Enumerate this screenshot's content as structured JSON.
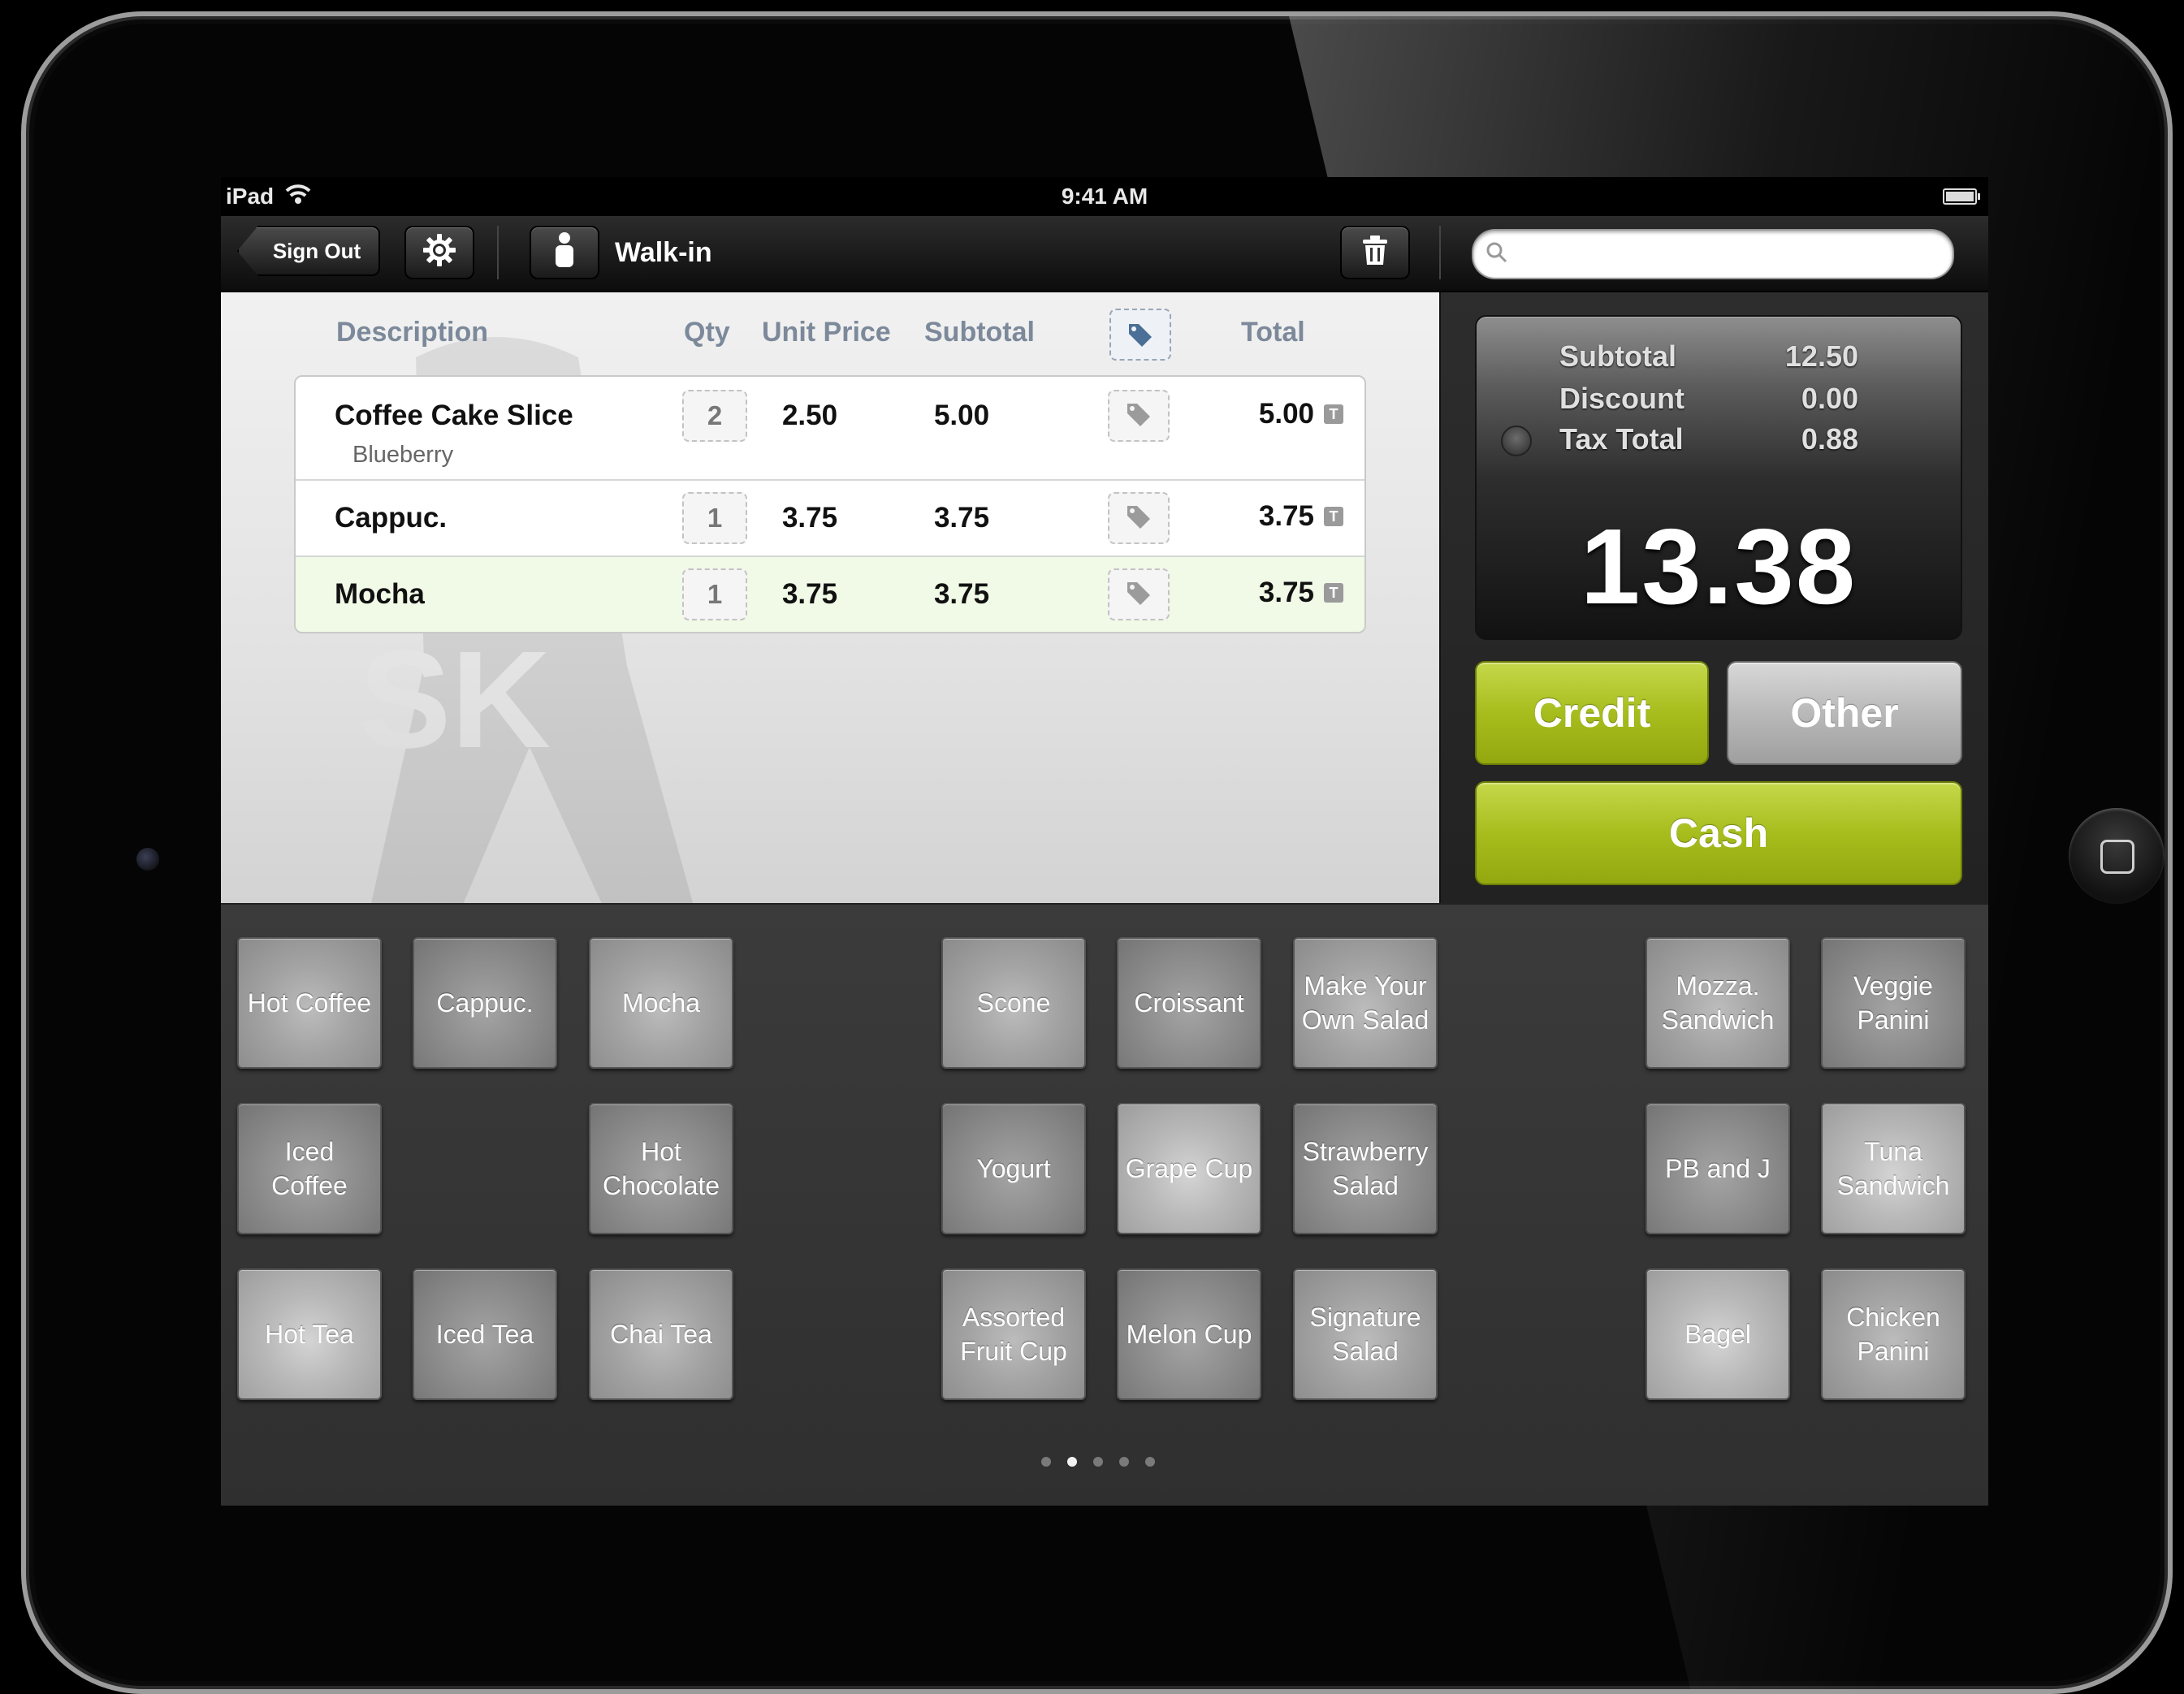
{
  "status_bar": {
    "device": "iPad",
    "time": "9:41 AM"
  },
  "toolbar": {
    "sign_out_label": "Sign Out",
    "customer_name": "Walk-in",
    "search_placeholder": ""
  },
  "order": {
    "headers": {
      "description": "Description",
      "qty": "Qty",
      "unit_price": "Unit Price",
      "subtotal": "Subtotal",
      "total": "Total"
    },
    "items": [
      {
        "name": "Coffee Cake Slice",
        "variant": "Blueberry",
        "qty": "2",
        "unit_price": "2.50",
        "subtotal": "5.00",
        "total": "5.00",
        "tax": "T"
      },
      {
        "name": "Cappuc.",
        "variant": "",
        "qty": "1",
        "unit_price": "3.75",
        "subtotal": "3.75",
        "total": "3.75",
        "tax": "T"
      },
      {
        "name": "Mocha",
        "variant": "",
        "qty": "1",
        "unit_price": "3.75",
        "subtotal": "3.75",
        "total": "3.75",
        "tax": "T"
      }
    ],
    "watermark": "SK"
  },
  "totals": {
    "subtotal_label": "Subtotal",
    "subtotal_value": "12.50",
    "discount_label": "Discount",
    "discount_value": "0.00",
    "tax_label": "Tax Total",
    "tax_value": "0.88",
    "grand_total": "13.38"
  },
  "payment": {
    "credit": "Credit",
    "other": "Other",
    "cash": "Cash",
    "green_color": "#a7bd1d"
  },
  "products": [
    {
      "label": "Hot Coffee"
    },
    {
      "label": "Cappuc."
    },
    {
      "label": "Mocha"
    },
    {
      "label": "Iced\nCoffee"
    },
    {
      "label": "Hot\nChocolate"
    },
    {
      "label": "Hot Tea"
    },
    {
      "label": "Iced Tea"
    },
    {
      "label": "Chai Tea"
    },
    {
      "label": "Scone"
    },
    {
      "label": "Croissant"
    },
    {
      "label": "Make Your\nOwn Salad"
    },
    {
      "label": "Yogurt"
    },
    {
      "label": "Grape Cup"
    },
    {
      "label": "Strawberry\nSalad"
    },
    {
      "label": "Assorted\nFruit Cup"
    },
    {
      "label": "Melon Cup"
    },
    {
      "label": "Signature\nSalad"
    },
    {
      "label": "Mozza.\nSandwich"
    },
    {
      "label": "Veggie\nPanini"
    },
    {
      "label": "PB and J"
    },
    {
      "label": "Tuna\nSandwich"
    },
    {
      "label": "Bagel"
    },
    {
      "label": "Chicken\nPanini"
    }
  ],
  "pagination": {
    "pages": 5,
    "current": 2
  }
}
